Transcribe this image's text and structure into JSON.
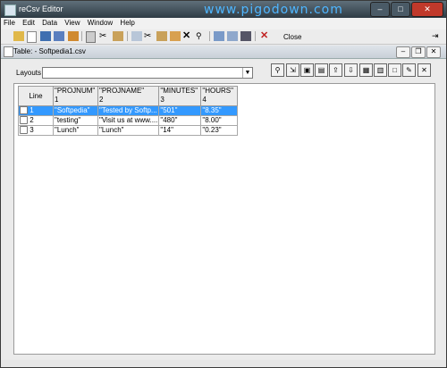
{
  "window": {
    "title": "reCsv Editor",
    "watermark": "www.pigodown.com"
  },
  "menu": [
    "File",
    "Edit",
    "Data",
    "View",
    "Window",
    "Help"
  ],
  "toolbar": {
    "close_label": "Close"
  },
  "inner": {
    "title": "Table:  - Softpedia1.csv"
  },
  "layouts": {
    "label": "Layouts",
    "value": ""
  },
  "table": {
    "columns": [
      {
        "name": "Line",
        "index": ""
      },
      {
        "name": "\"PROJNUM\"",
        "index": "1"
      },
      {
        "name": "\"PROJNAME\"",
        "index": "2"
      },
      {
        "name": "\"MINUTES\"",
        "index": "3"
      },
      {
        "name": "\"HOURS\"",
        "index": "4"
      }
    ],
    "rows": [
      {
        "line": "1",
        "cells": [
          "\"Softpedia\"",
          "\"Tested by Softp...",
          "\"501\"",
          "\"8.35\""
        ],
        "selected": true
      },
      {
        "line": "2",
        "cells": [
          "\"testing\"",
          "\"Visit us at www....",
          "\"480\"",
          "\"8.00\""
        ],
        "selected": false
      },
      {
        "line": "3",
        "cells": [
          "\"Lunch\"",
          "\"Lunch\"",
          "\"14\"",
          "\"0.23\""
        ],
        "selected": false
      }
    ]
  }
}
